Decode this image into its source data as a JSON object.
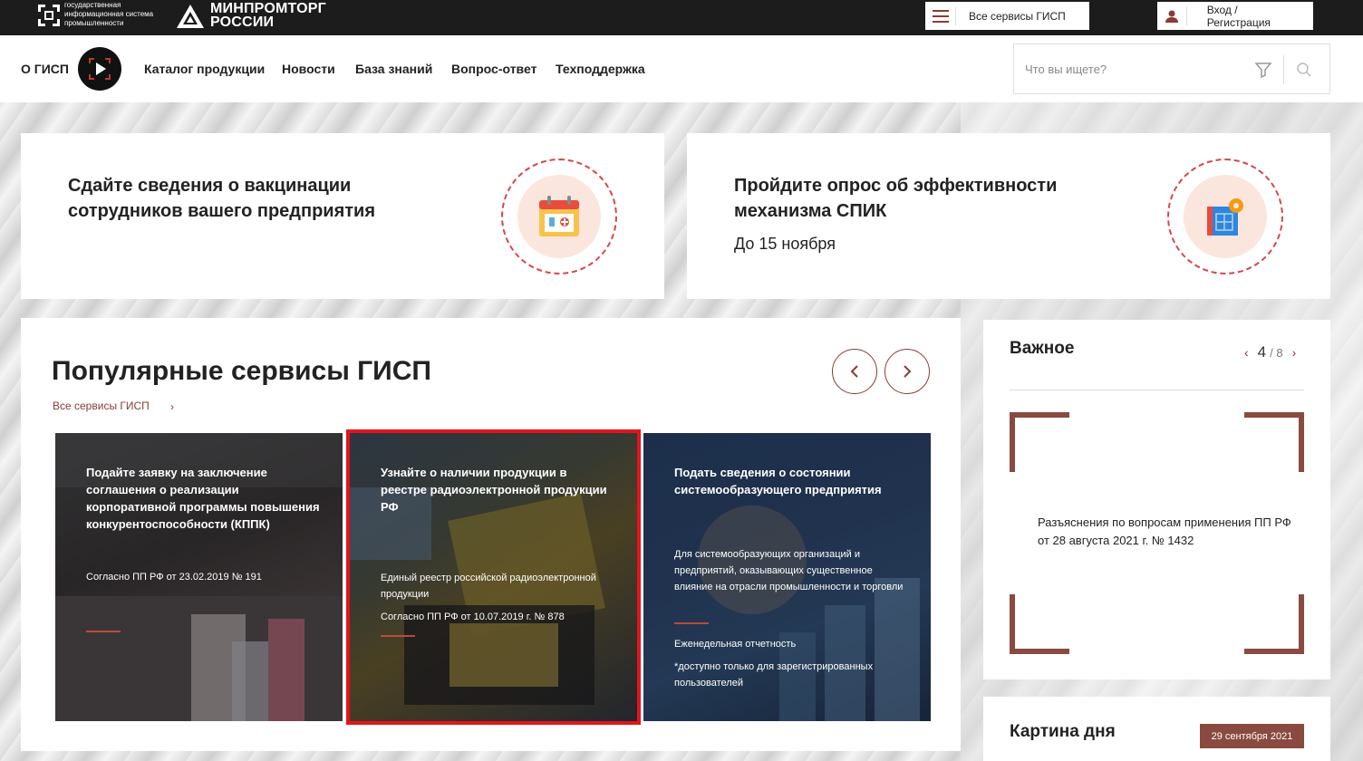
{
  "header": {
    "gisp_text": "государственная информационная система промышленности",
    "ministry_text_line1": "МИНПРОМТОРГ",
    "ministry_text_line2": "РОССИИ",
    "services_button": "Все сервисы ГИСП",
    "login_button": "Вход / Регистрация"
  },
  "nav": {
    "items": [
      "О ГИСП",
      "Каталог продукции",
      "Новости",
      "База знаний",
      "Вопрос-ответ",
      "Техподдержка"
    ],
    "search_placeholder": "Что вы ищете?"
  },
  "banners": [
    {
      "title_line1": "Сдайте сведения о вакцинации",
      "title_line2": "сотрудников вашего предприятия",
      "icon": "calendar-icon"
    },
    {
      "title_line1": "Пройдите опрос об эффективности",
      "title_line2": "механизма СПИК",
      "subtitle": "До 15 ноября",
      "icon": "blueprint-gear-icon"
    }
  ],
  "popular": {
    "title": "Популярные сервисы ГИСП",
    "all_link": "Все сервисы ГИСП",
    "cards": [
      {
        "title": "Подайте заявку на заключение соглашения о реализации корпоративной программы повышения конкурентоспособности (КППК)",
        "text1": "Согласно ПП РФ от 23.02.2019 № 191"
      },
      {
        "title": "Узнайте о наличии продукции в реестре радиоэлектронной продукции РФ",
        "text1": "Единый реестр российской радиоэлектронной продукции",
        "text2": "Согласно ПП РФ от 10.07.2019 г. № 878"
      },
      {
        "title": "Подать сведения о состоянии системообразующего предприятия",
        "text1": "Для системообразующих организаций и предприятий, оказывающих существенное влияние на отрасли промышленности и торговли",
        "text2": "Еженедельная отчетность",
        "text3": "*доступно только для зарегистрированных пользователей"
      }
    ]
  },
  "important": {
    "title": "Важное",
    "page_current": "4",
    "page_total": "8",
    "text": "Разъяснения по вопросам применения ПП РФ от 28 августа 2021 г. № 1432"
  },
  "picture_of_day": {
    "title": "Картина дня",
    "date": "29 сентября 2021"
  },
  "colors": {
    "accent": "#8a3b34",
    "highlight": "#e5141b",
    "ring": "#d8454a"
  }
}
